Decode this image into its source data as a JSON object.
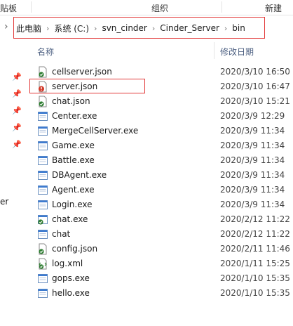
{
  "ribbon": {
    "groups": [
      "贴板",
      "组织",
      "新建"
    ]
  },
  "address_bar": {
    "crumbs": [
      "此电脑",
      "系统 (C:)",
      "svn_cinder",
      "Cinder_Server",
      "bin"
    ]
  },
  "nav_pane": {
    "partial_label": "er"
  },
  "columns": {
    "name": "名称",
    "modified": "修改日期"
  },
  "files": [
    {
      "name": "cellserver.json",
      "modified": "2020/3/10 16:50",
      "icon": "json-file-icon"
    },
    {
      "name": "server.json",
      "modified": "2020/3/10 16:47",
      "icon": "json-file-icon"
    },
    {
      "name": "chat.json",
      "modified": "2020/3/10 15:21",
      "icon": "json-file-icon"
    },
    {
      "name": "Center.exe",
      "modified": "2020/3/9 12:29",
      "icon": "exe-file-icon"
    },
    {
      "name": "MergeCellServer.exe",
      "modified": "2020/3/9 11:34",
      "icon": "exe-file-icon"
    },
    {
      "name": "Game.exe",
      "modified": "2020/3/9 11:34",
      "icon": "exe-file-icon"
    },
    {
      "name": "Battle.exe",
      "modified": "2020/3/9 11:34",
      "icon": "exe-file-icon"
    },
    {
      "name": "DBAgent.exe",
      "modified": "2020/3/9 11:34",
      "icon": "exe-file-icon"
    },
    {
      "name": "Agent.exe",
      "modified": "2020/3/9 11:34",
      "icon": "exe-file-icon"
    },
    {
      "name": "Login.exe",
      "modified": "2020/3/9 11:34",
      "icon": "exe-file-icon"
    },
    {
      "name": "chat.exe",
      "modified": "2020/2/12 11:22",
      "icon": "checked-file-icon"
    },
    {
      "name": "chat",
      "modified": "2020/2/12 11:22",
      "icon": "exe-file-icon"
    },
    {
      "name": "config.json",
      "modified": "2020/2/11 11:46",
      "icon": "json-file-icon"
    },
    {
      "name": "log.xml",
      "modified": "2020/1/11 15:25",
      "icon": "xml-file-icon"
    },
    {
      "name": "gops.exe",
      "modified": "2020/1/10 15:35",
      "icon": "exe-file-icon"
    },
    {
      "name": "hello.exe",
      "modified": "2020/1/10 15:35",
      "icon": "exe-file-icon"
    }
  ],
  "highlighted_file": "server.json",
  "colors": {
    "highlight_border": "#e23a3a",
    "header_text": "#4d6082"
  }
}
